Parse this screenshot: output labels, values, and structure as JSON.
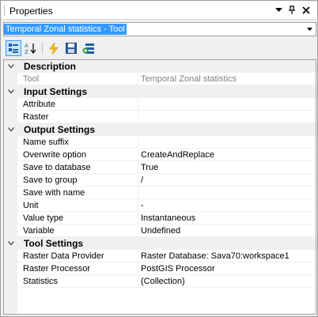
{
  "window": {
    "title": "Properties"
  },
  "titlebar_buttons": [
    "chevron-down-icon",
    "pin-icon",
    "close-icon"
  ],
  "object_selector": {
    "value": "Temporal Zonal statistics - Tool"
  },
  "toolbar": {
    "buttons": [
      "categorized-view-icon",
      "alphabetical-sort-icon",
      "events-icon",
      "save-icon",
      "add-table-icon"
    ],
    "active": "categorized-view-icon"
  },
  "categories": [
    {
      "label": "Description",
      "rows": [
        {
          "name": "Tool",
          "value": "Temporal Zonal statistics",
          "readonly": true
        }
      ]
    },
    {
      "label": "Input Settings",
      "rows": [
        {
          "name": "Attribute",
          "value": ""
        },
        {
          "name": "Raster",
          "value": ""
        }
      ]
    },
    {
      "label": "Output Settings",
      "rows": [
        {
          "name": "Name suffix",
          "value": ""
        },
        {
          "name": "Overwrite option",
          "value": "CreateAndReplace"
        },
        {
          "name": "Save to database",
          "value": "True"
        },
        {
          "name": "Save to group",
          "value": "/"
        },
        {
          "name": "Save with name",
          "value": ""
        },
        {
          "name": "Unit",
          "value": "-"
        },
        {
          "name": "Value type",
          "value": "Instantaneous"
        },
        {
          "name": "Variable",
          "value": "Undefined"
        }
      ]
    },
    {
      "label": "Tool Settings",
      "rows": [
        {
          "name": "Raster Data Provider",
          "value": "Raster Database: Sava70:workspace1"
        },
        {
          "name": "Raster Processor",
          "value": "PostGIS Processor"
        },
        {
          "name": "Statistics",
          "value": "(Collection)"
        }
      ]
    }
  ],
  "colors": {
    "selection": "#3399ff",
    "gutter": "#f0f0f0",
    "readonly_text": "#808080"
  }
}
